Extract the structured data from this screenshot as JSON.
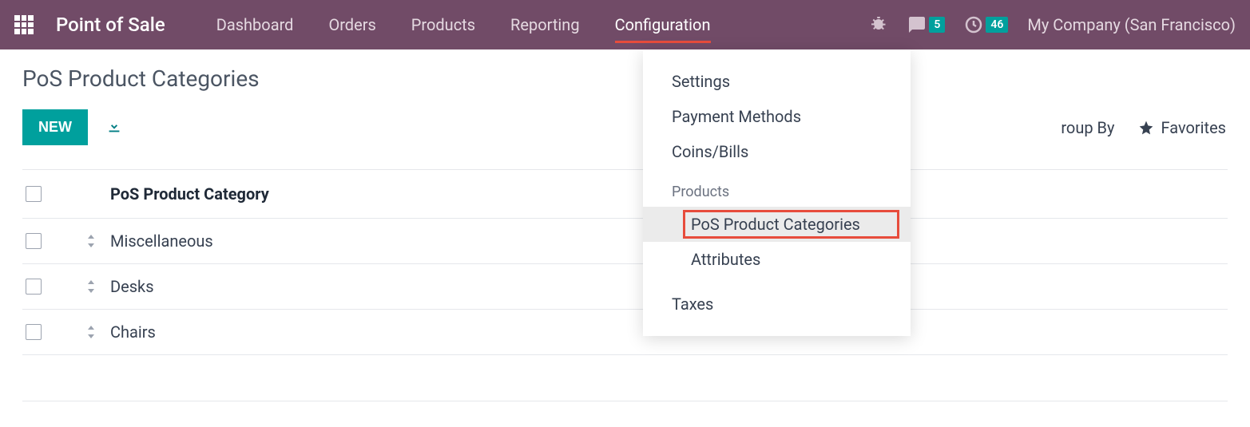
{
  "navbar": {
    "app_title": "Point of Sale",
    "menu": [
      {
        "label": "Dashboard",
        "active": false
      },
      {
        "label": "Orders",
        "active": false
      },
      {
        "label": "Products",
        "active": false
      },
      {
        "label": "Reporting",
        "active": false
      },
      {
        "label": "Configuration",
        "active": true
      }
    ],
    "messages_badge": "5",
    "activities_badge": "46",
    "company": "My Company (San Francisco)"
  },
  "dropdown": {
    "items": [
      {
        "label": "Settings",
        "type": "item"
      },
      {
        "label": "Payment Methods",
        "type": "item"
      },
      {
        "label": "Coins/Bills",
        "type": "item"
      },
      {
        "label": "Products",
        "type": "section"
      },
      {
        "label": "PoS Product Categories",
        "type": "subitem",
        "highlighted": true
      },
      {
        "label": "Attributes",
        "type": "subitem"
      },
      {
        "label": "Taxes",
        "type": "item"
      }
    ]
  },
  "page": {
    "title": "PoS Product Categories",
    "new_button": "NEW",
    "toolbar": {
      "group_by": "roup By",
      "favorites": "Favorites"
    }
  },
  "table": {
    "header": "PoS Product Category",
    "rows": [
      {
        "name": "Miscellaneous"
      },
      {
        "name": "Desks"
      },
      {
        "name": "Chairs"
      }
    ]
  }
}
